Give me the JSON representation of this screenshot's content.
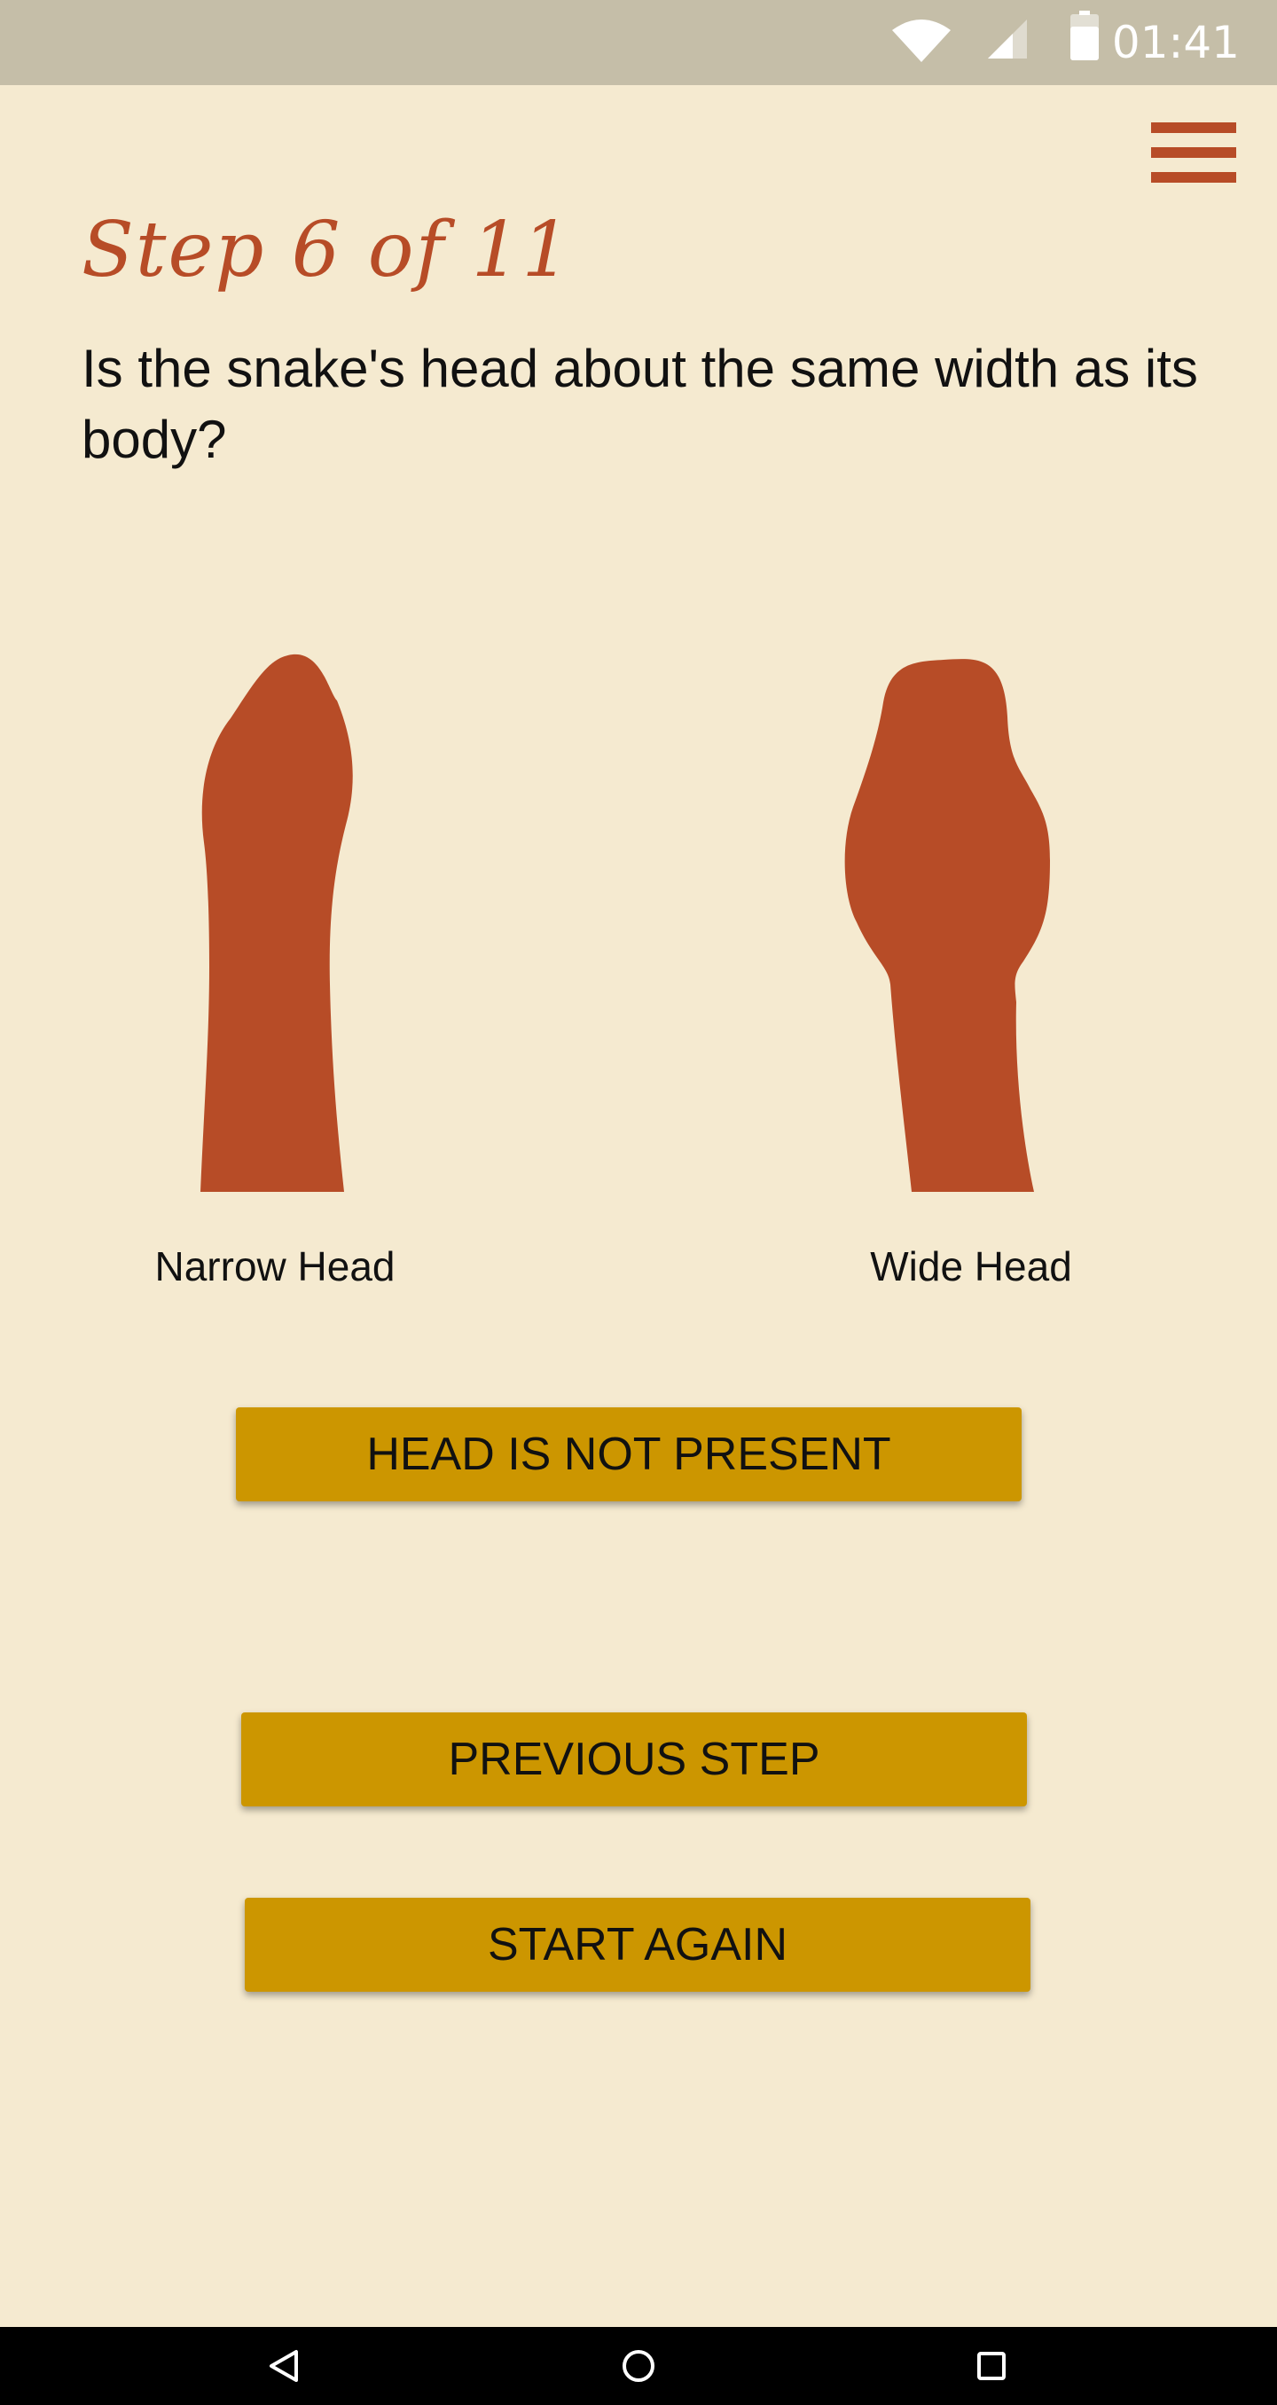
{
  "status_bar": {
    "time": "01:41",
    "icons": [
      "wifi-icon",
      "cell-signal-icon",
      "battery-icon"
    ]
  },
  "header": {
    "menu_icon": "hamburger-menu-icon"
  },
  "step": {
    "title": "Step 6 of 11",
    "question": "Is the snake's head about the same width as its body?"
  },
  "options": [
    {
      "label": "Narrow Head",
      "icon": "narrow-head-icon"
    },
    {
      "label": "Wide Head",
      "icon": "wide-head-icon"
    }
  ],
  "buttons": {
    "head_not_present": "HEAD IS NOT PRESENT",
    "previous_step": "PREVIOUS STEP",
    "start_again": "START AGAIN"
  },
  "nav_bar": {
    "icons": [
      "back-icon",
      "home-icon",
      "recents-icon"
    ]
  },
  "colors": {
    "background": "#f5ead0",
    "status_bar": "#c5bea8",
    "accent": "#b74c27",
    "button": "#cc9600",
    "text": "#111111"
  }
}
